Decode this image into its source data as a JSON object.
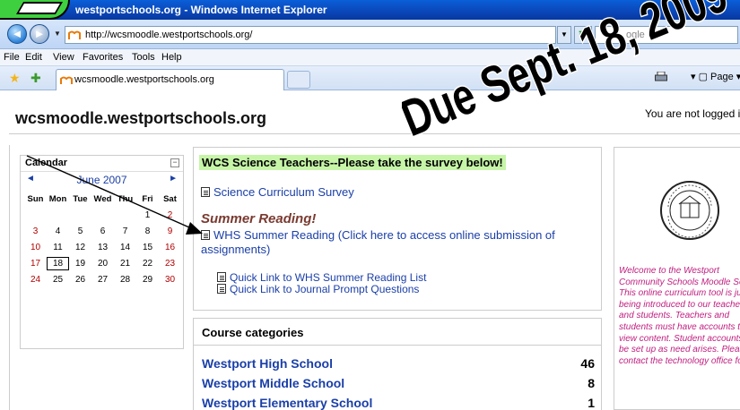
{
  "window": {
    "title": "westportschools.org - Windows Internet Explorer"
  },
  "toolbar": {
    "address": "http://wcsmoodle.westportschools.org/",
    "search_placeholder": "ogle"
  },
  "menu": [
    "File",
    "Edit",
    "View",
    "Favorites",
    "Tools",
    "Help"
  ],
  "tab": {
    "label": "wcsmoodle.westportschools.org"
  },
  "toolbar_right": {
    "page_label": "Page"
  },
  "site": {
    "name": "wcsmoodle.westportschools.org",
    "login_status": "You are not logged in"
  },
  "calendar": {
    "title": "Calendar",
    "collapse": "−",
    "month": "June 2007",
    "prev": "◄",
    "next": "►",
    "dow": [
      "Sun",
      "Mon",
      "Tue",
      "Wed",
      "Thu",
      "Fri",
      "Sat"
    ],
    "weeks": [
      [
        "",
        "",
        "",
        "",
        "",
        "1",
        "2"
      ],
      [
        "3",
        "4",
        "5",
        "6",
        "7",
        "8",
        "9"
      ],
      [
        "10",
        "11",
        "12",
        "13",
        "14",
        "15",
        "16"
      ],
      [
        "17",
        "18",
        "19",
        "20",
        "21",
        "22",
        "23"
      ],
      [
        "24",
        "25",
        "26",
        "27",
        "28",
        "29",
        "30"
      ]
    ],
    "today": "18"
  },
  "main": {
    "banner": "WCS Science Teachers--Please take the survey below!",
    "survey_link": "Science Curriculum Survey",
    "summer_heading": "Summer Reading!",
    "summer_link": "WHS Summer Reading (Click here to access online submission of assignments)",
    "quick_link_1": "Quick Link to WHS Summer Reading List",
    "quick_link_2": "Quick Link to Journal Prompt Questions"
  },
  "categories": {
    "title": "Course categories",
    "items": [
      {
        "name": "Westport High School",
        "count": "46"
      },
      {
        "name": "Westport Middle School",
        "count": "8"
      },
      {
        "name": "Westport Elementary School",
        "count": "1"
      }
    ]
  },
  "sidebar_right": {
    "welcome": "Welcome to the Westport Community Schools Moodle Server! This online curriculum tool is just being introduced to our teachers and students. Teachers and students must have accounts to view content. Student accounts will be set up as need arises. Please contact the technology office for"
  },
  "annotation": {
    "due_text": "Due Sept. 18, 2009"
  },
  "colors": {
    "link": "#1a3fa8",
    "banner_highlight": "#c6f5a8",
    "weekend": "#b00000",
    "welcome_text": "#c02080"
  }
}
